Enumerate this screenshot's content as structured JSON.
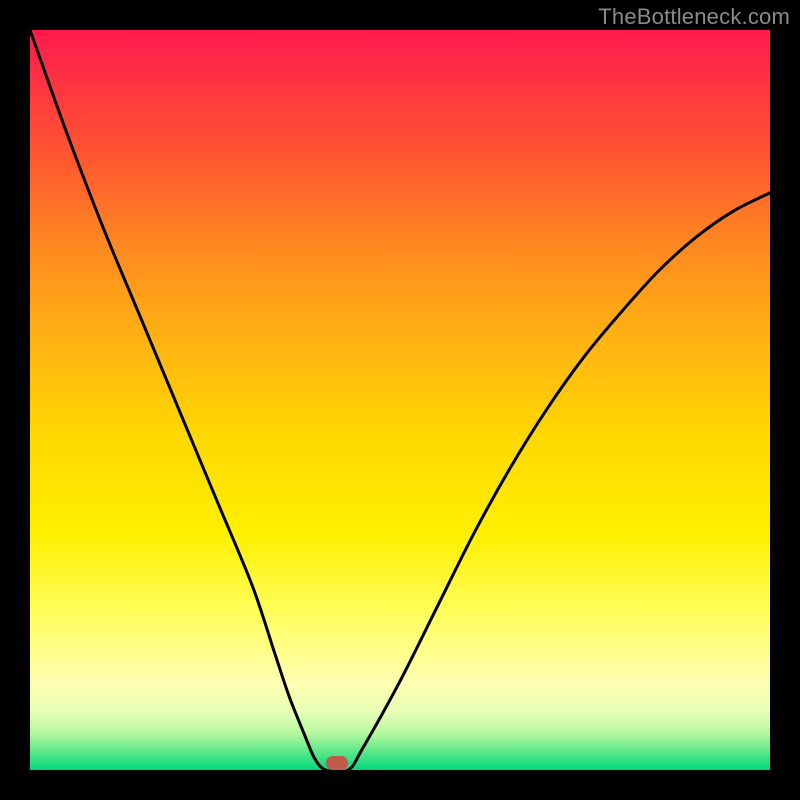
{
  "watermark": "TheBottleneck.com",
  "chart_data": {
    "type": "line",
    "title": "",
    "xlabel": "",
    "ylabel": "",
    "xlim": [
      0,
      100
    ],
    "ylim": [
      0,
      100
    ],
    "grid": false,
    "series": [
      {
        "name": "curve",
        "x": [
          0,
          5,
          10,
          15,
          20,
          25,
          30,
          33,
          35,
          37,
          38.5,
          40,
          43,
          45,
          50,
          55,
          60,
          65,
          70,
          75,
          80,
          85,
          90,
          95,
          100
        ],
        "values": [
          100,
          86,
          73,
          61,
          49,
          37,
          25,
          16,
          10,
          5,
          1.5,
          0,
          0,
          3,
          12,
          22,
          32,
          41,
          49,
          56,
          62,
          67.5,
          72,
          75.5,
          78
        ]
      }
    ],
    "marker": {
      "x": 41.5,
      "y": 1
    },
    "colors": {
      "curve": "#000000",
      "marker": "#c25a4a",
      "frame": "#000000",
      "gradient_top": "#ff1a4e",
      "gradient_bottom": "#00d97e"
    }
  }
}
